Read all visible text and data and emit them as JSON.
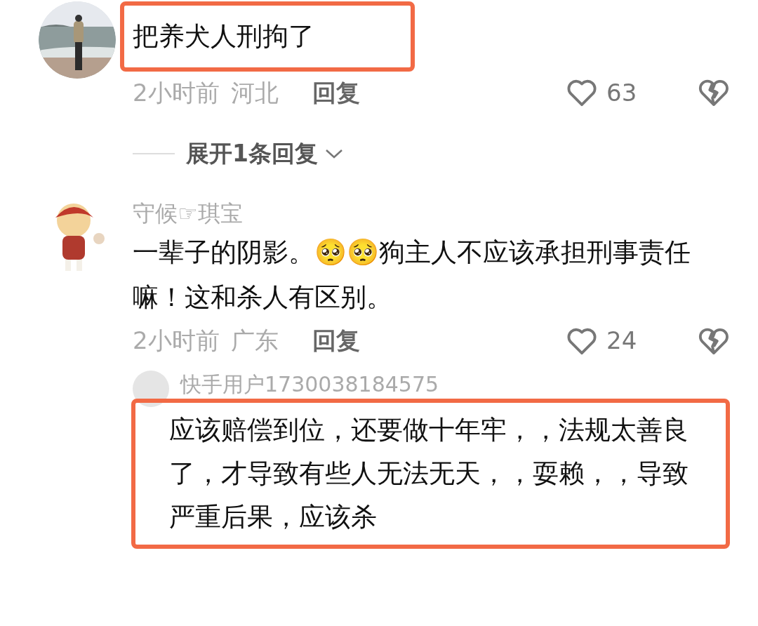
{
  "comments": [
    {
      "text": "把养犬人刑拘了",
      "highlighted": true,
      "time": "2小时前",
      "location": "河北",
      "reply_label": "回复",
      "likes": "63",
      "expand": "展开1条回复"
    },
    {
      "avatar": {
        "kind": "figure"
      },
      "username": "守候☞琪宝",
      "text": "一辈子的阴影。🥺🥺狗主人不应该承担刑事责任嘛！这和杀人有区别。",
      "highlighted": false,
      "time": "2小时前",
      "location": "广东",
      "reply_label": "回复",
      "likes": "24",
      "replies": [
        {
          "username": "快手用户1730038184575",
          "text": "应该赔偿到位，还要做十年牢，，法规太善良了，才导致有些人无法无天，，耍赖，，导致严重后果，应该杀",
          "highlighted": true
        }
      ]
    }
  ]
}
